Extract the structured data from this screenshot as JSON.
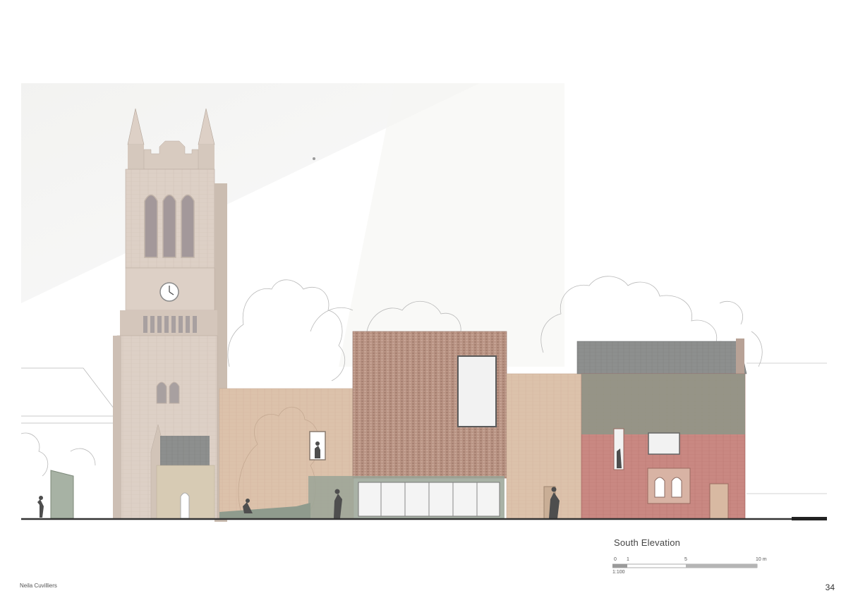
{
  "drawing": {
    "title": "South Elevation",
    "scale_ratio": "1:100",
    "scale_ticks": [
      "0",
      "1",
      "5",
      "10 m"
    ]
  },
  "footer": {
    "author": "Neila Cuvilliers",
    "page_number": "34"
  },
  "colors": {
    "sky_wash": "#f3f3f1",
    "stone": "#ddd0c6",
    "stone_dark": "#c9bbb0",
    "brick_buff": "#dcc2ab",
    "brick_red": "#b99080",
    "brick_heritage": "#c98882",
    "slate": "#8d8f8e",
    "green_glaze": "#8a9788",
    "ground": "#333333"
  }
}
